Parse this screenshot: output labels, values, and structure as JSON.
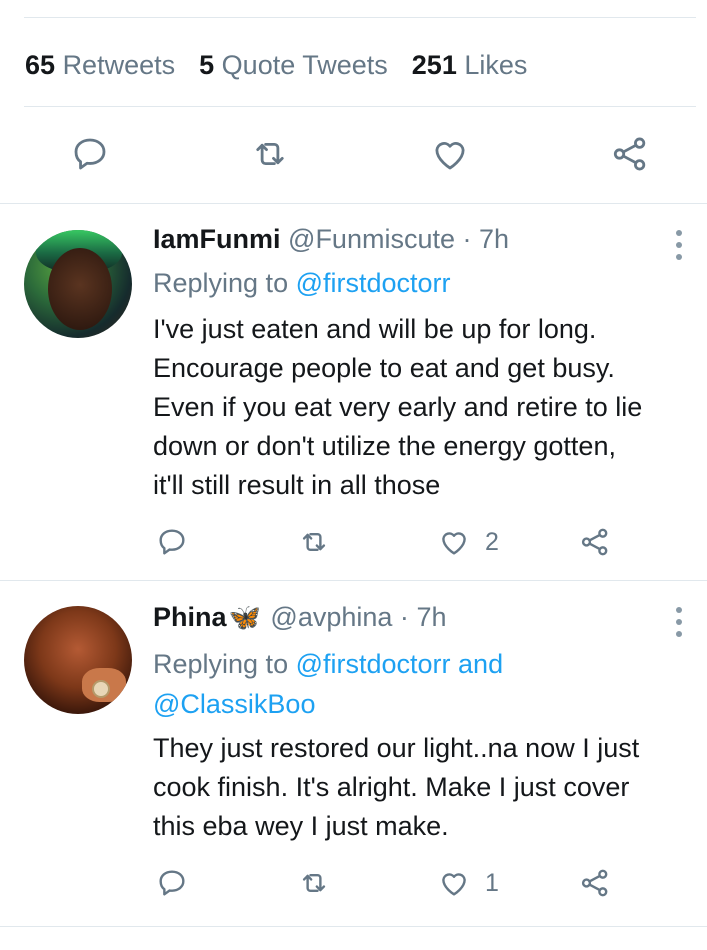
{
  "stats": {
    "retweets_count": "65",
    "retweets_label": "Retweets",
    "quotes_count": "5",
    "quotes_label": "Quote Tweets",
    "likes_count": "251",
    "likes_label": "Likes"
  },
  "main_actions": [
    "reply-icon",
    "retweet-icon",
    "like-icon",
    "share-icon"
  ],
  "colors": {
    "accent": "#1da1f2",
    "secondary_text": "#657786",
    "divider": "#e1e8ed",
    "icon": "#657786"
  },
  "replies": [
    {
      "name": "IamFunmi",
      "handle": "@Funmiscute",
      "dot": "·",
      "time": "7h",
      "replying_prefix": "Replying to",
      "replying_to": "@firstdoctorr",
      "text_lines": [
        "I've just eaten and will be up for long.",
        "Encourage people to eat and get busy.",
        "Even if you eat very early and retire to lie",
        "down or don't utilize the energy gotten,",
        "it'll still result in all those"
      ],
      "like_count": "2"
    },
    {
      "name": "Phina",
      "name_emoji": "🦋",
      "handle": "@avphina",
      "dot": "·",
      "time": "7h",
      "replying_prefix": "Replying to",
      "replying_to": "@firstdoctorr and",
      "replying_to_line2": "@ClassikBoo",
      "text_lines": [
        "They just restored our light..na now I just",
        "cook finish. It's alright. Make I just cover",
        "this eba wey I just make."
      ],
      "like_count": "1"
    }
  ]
}
